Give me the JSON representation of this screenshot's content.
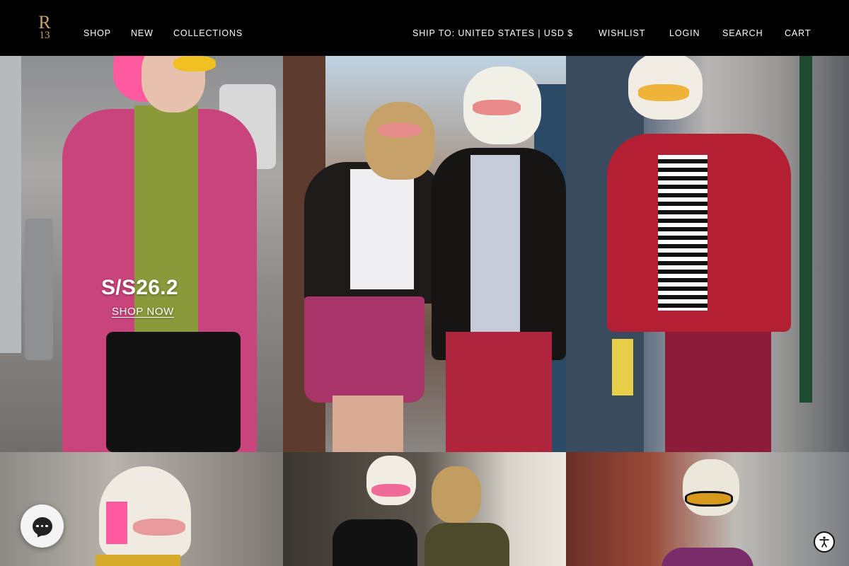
{
  "brand": {
    "logo_top": "R",
    "logo_bottom": "13",
    "color": "#c9a55c"
  },
  "nav": {
    "shop": "SHOP",
    "new": "NEW",
    "collections": "COLLECTIONS",
    "ship_to": "SHIP TO: UNITED STATES | USD $",
    "wishlist": "WISHLIST",
    "login": "LOGIN",
    "search": "SEARCH",
    "cart": "CART"
  },
  "hero": {
    "title": "S/S26.2",
    "cta": "SHOP NOW"
  },
  "widgets": {
    "chat_icon": "chat-icon",
    "accessibility_icon": "accessibility-icon"
  }
}
